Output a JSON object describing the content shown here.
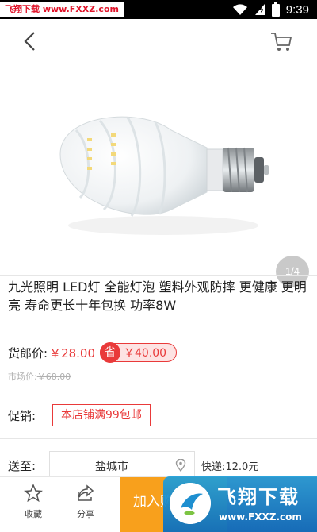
{
  "status_bar": {
    "watermark": "飞翔下载 www.FXXZ.com",
    "time": "9:39"
  },
  "nav": {
    "back_icon": "chevron-left-icon",
    "cart_icon": "cart-icon"
  },
  "gallery": {
    "page_indicator": "1/4",
    "image": "led-bulb-product-photo"
  },
  "product": {
    "title": "九光照明 LED灯 全能灯泡 塑料外观防摔 更健康 更明亮 寿命更长十年包换 功率8W"
  },
  "price": {
    "label": "货郎价:",
    "value": "￥28.00",
    "discount_icon_char": "省",
    "discount_value": "￥40.00",
    "market_label": "市场价:",
    "market_value": "￥68.00"
  },
  "promo": {
    "label": "促销:",
    "tag": "本店铺满99包邮"
  },
  "shipping": {
    "label": "送至:",
    "city": "盐城市",
    "fee": "快递:12.0元"
  },
  "bottom_bar": {
    "favorite_label": "收藏",
    "share_label": "分享",
    "add_to_cart_label": "加入购物车"
  },
  "overlay_watermark": {
    "text": "飞翔下载",
    "url": "www.FXXZ.com"
  },
  "colors": {
    "accent_red": "#e93a3a",
    "cart_orange": "#f8a01c",
    "watermark_blue": "#1e8fd0"
  }
}
